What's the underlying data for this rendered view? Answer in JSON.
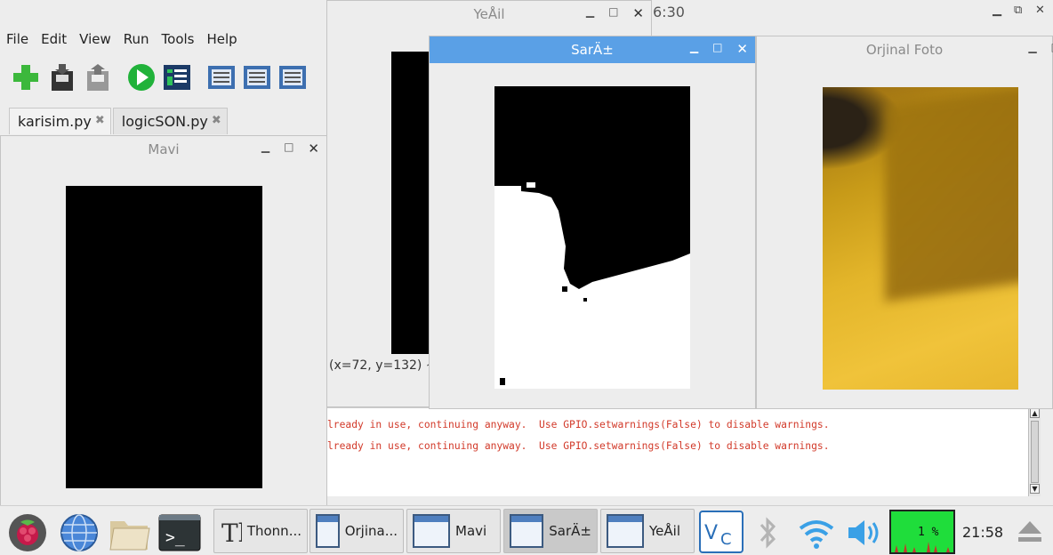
{
  "menu": [
    "File",
    "Edit",
    "View",
    "Run",
    "Tools",
    "Help"
  ],
  "tabs": [
    {
      "label": "karisim.py"
    },
    {
      "label": "logicSON.py"
    }
  ],
  "tab_close": "✖",
  "clock_fragment": "6:30",
  "cursor_readout": "(x=72, y=132) ~",
  "console_lines": [
    "lready in use, continuing anyway.  Use GPIO.setwarnings(False) to disable warnings.",
    "lready in use, continuing anyway.  Use GPIO.setwarnings(False) to disable warnings."
  ],
  "windows": {
    "yesil": {
      "title": "YeÅil"
    },
    "sari": {
      "title": "SarÄ±"
    },
    "orjinal": {
      "title": "Orjinal Foto"
    },
    "mavi": {
      "title": "Mavi"
    }
  },
  "taskbar": {
    "items": [
      "Thonn...",
      "Orjina...",
      "Mavi",
      "SarÄ±",
      "YeÅil"
    ],
    "cpu": "1 %",
    "time": "21:58"
  },
  "colors": {
    "focused_title": "#5aa0e6",
    "console_text": "#d23a2a",
    "cpu_bg": "#1fdd3b"
  }
}
